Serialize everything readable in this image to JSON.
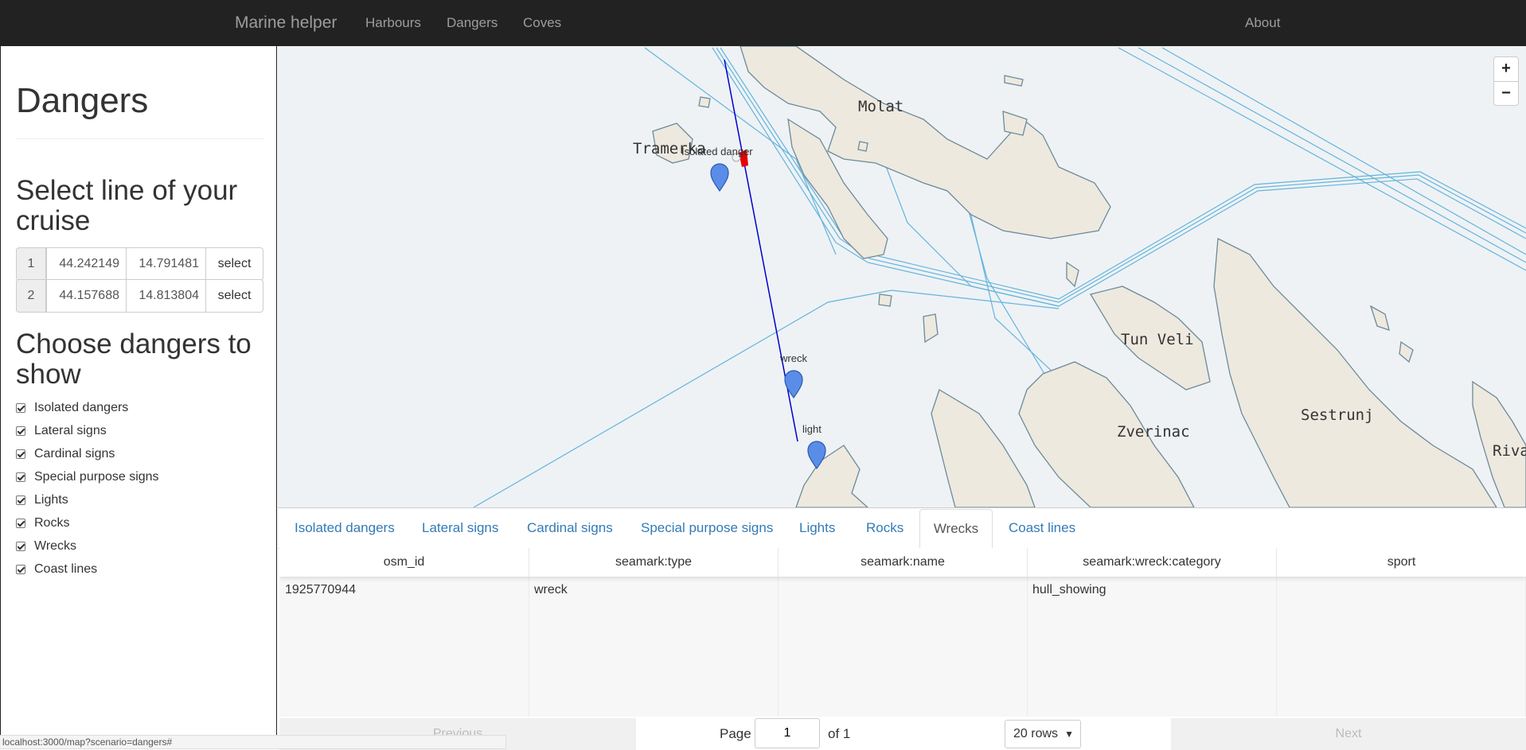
{
  "navbar": {
    "brand": "Marine helper",
    "links": [
      "Harbours",
      "Dangers",
      "Coves"
    ],
    "about": "About"
  },
  "sidebar": {
    "title": "Dangers",
    "select_heading": "Select line of your cruise",
    "points": [
      {
        "index": "1",
        "lat": "44.242149",
        "lon": "14.791481",
        "button": "select"
      },
      {
        "index": "2",
        "lat": "44.157688",
        "lon": "14.813804",
        "button": "select"
      }
    ],
    "choose_heading": "Choose dangers to show",
    "checkboxes": [
      {
        "label": "Isolated dangers",
        "checked": true
      },
      {
        "label": "Lateral signs",
        "checked": true
      },
      {
        "label": "Cardinal signs",
        "checked": true
      },
      {
        "label": "Special purpose signs",
        "checked": true
      },
      {
        "label": "Lights",
        "checked": true
      },
      {
        "label": "Rocks",
        "checked": true
      },
      {
        "label": "Wrecks",
        "checked": true
      },
      {
        "label": "Coast lines",
        "checked": true
      }
    ]
  },
  "map": {
    "zoom_in": "+",
    "zoom_out": "−",
    "place_labels": [
      "Molat",
      "Tramerka",
      "Tun Veli",
      "Zverinac",
      "Sestrunj",
      "Riva"
    ],
    "markers": [
      "Isolated danger",
      "wreck",
      "light"
    ],
    "colors": {
      "water": "#eef2f5",
      "land": "#ede9df",
      "coast": "#6d8a99",
      "route": "#0000cc",
      "seaway": "#64b4dc"
    }
  },
  "tabs": {
    "items": [
      "Isolated dangers",
      "Lateral signs",
      "Cardinal signs",
      "Special purpose signs",
      "Lights",
      "Rocks",
      "Wrecks",
      "Coast lines"
    ],
    "active": "Wrecks"
  },
  "table": {
    "columns": [
      "osm_id",
      "seamark:type",
      "seamark:name",
      "seamark:wreck:category",
      "sport"
    ],
    "rows": [
      [
        "1925770944",
        "wreck",
        "",
        "hull_showing",
        ""
      ]
    ]
  },
  "pager": {
    "previous": "Previous",
    "page_label": "Page",
    "page_value": "1",
    "of_label": "of 1",
    "rows_option": "20 rows",
    "next": "Next"
  },
  "status_url": "localhost:3000/map?scenario=dangers#"
}
